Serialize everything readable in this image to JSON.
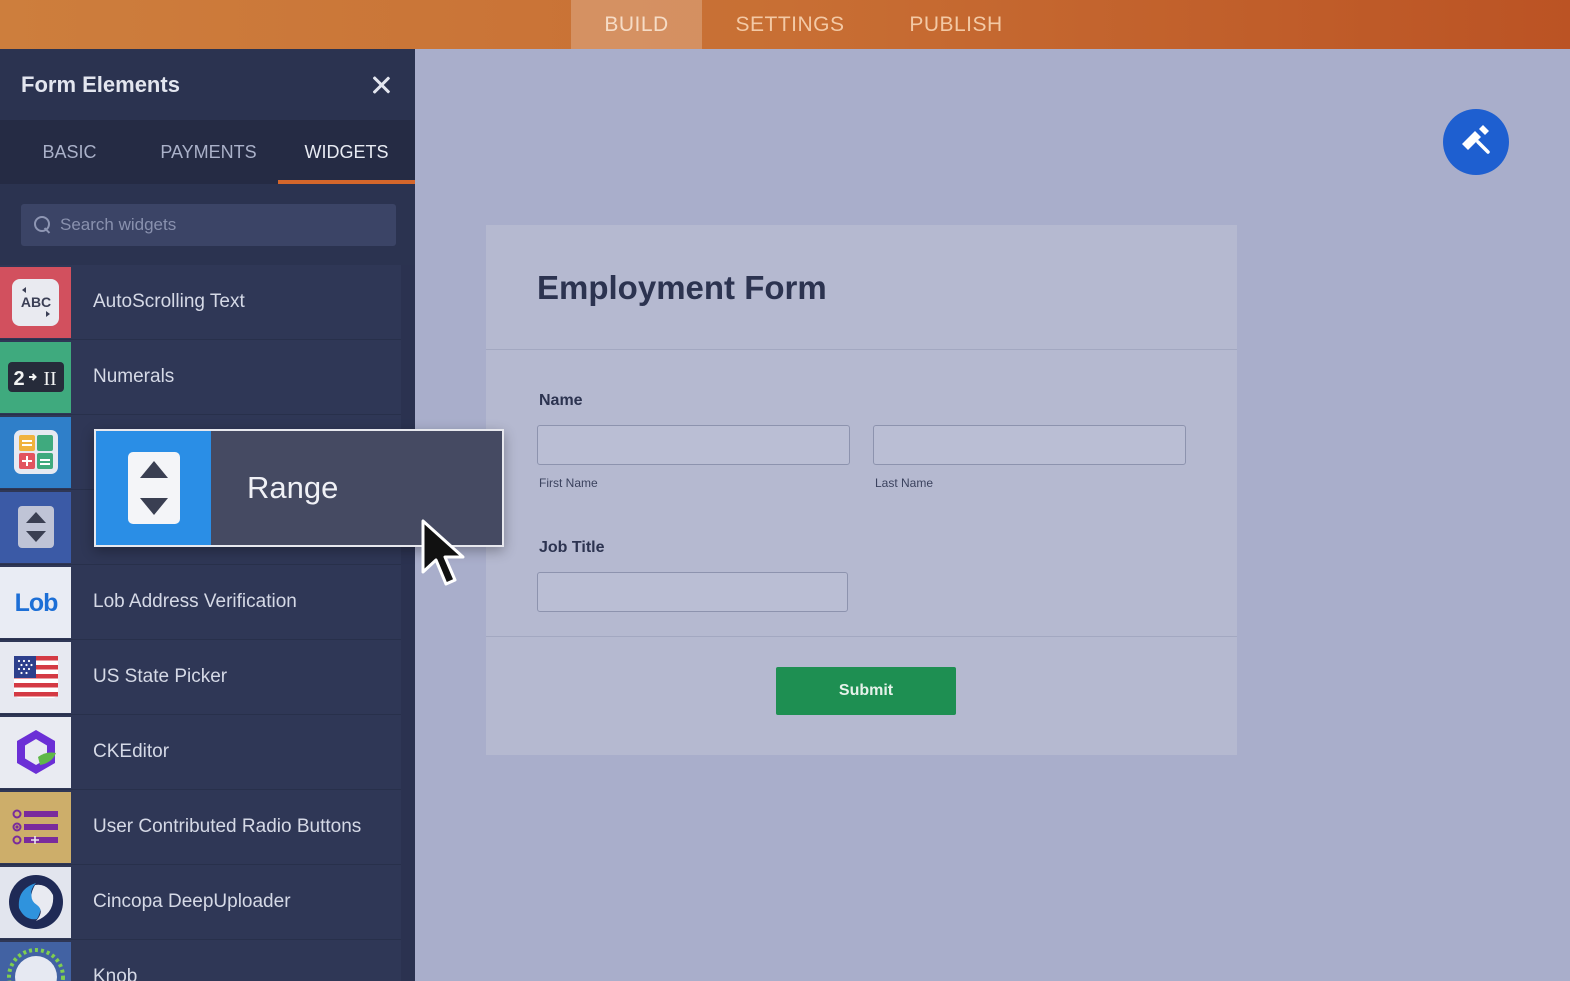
{
  "top_nav": {
    "tabs": [
      {
        "label": "BUILD",
        "active": true
      },
      {
        "label": "SETTINGS",
        "active": false
      },
      {
        "label": "PUBLISH",
        "active": false
      }
    ]
  },
  "sidebar": {
    "title": "Form Elements",
    "tabs": [
      {
        "label": "BASIC",
        "active": false
      },
      {
        "label": "PAYMENTS",
        "active": false
      },
      {
        "label": "WIDGETS",
        "active": true
      }
    ],
    "search_placeholder": "Search widgets",
    "widgets": [
      {
        "label": "AutoScrolling Text",
        "icon": "abc-text-icon",
        "bg": "#d2505e"
      },
      {
        "label": "Numerals",
        "icon": "numerals-icon",
        "bg": "#3faa7e"
      },
      {
        "label": "",
        "icon": "calculator-icon",
        "bg": "#2f7fc9"
      },
      {
        "label": "",
        "icon": "range-icon",
        "bg": "#3b5aa6"
      },
      {
        "label": "Lob Address Verification",
        "icon": "lob-icon",
        "bg": "#e9ecf4"
      },
      {
        "label": "US State Picker",
        "icon": "us-flag-icon",
        "bg": "#e7e9f1"
      },
      {
        "label": "CKEditor",
        "icon": "ckeditor-icon",
        "bg": "#e9ebf2"
      },
      {
        "label": "User Contributed Radio Buttons",
        "icon": "radio-list-icon",
        "bg": "#cdae6a"
      },
      {
        "label": "Cincopa DeepUploader",
        "icon": "cincopa-icon",
        "bg": "#e2e5ee"
      },
      {
        "label": "Knob",
        "icon": "knob-icon",
        "bg": "#4262a3"
      }
    ]
  },
  "drag_ghost": {
    "label": "Range",
    "icon": "range-icon"
  },
  "form": {
    "title": "Employment Form",
    "name_label": "Name",
    "first_name_sublabel": "First Name",
    "last_name_sublabel": "Last Name",
    "job_title_label": "Job Title",
    "submit_label": "Submit"
  },
  "colors": {
    "accent": "#d4662b",
    "sidebar_bg": "#2f3756",
    "submit_green": "#1e8f52",
    "designer_blue": "#1e5fd0"
  }
}
